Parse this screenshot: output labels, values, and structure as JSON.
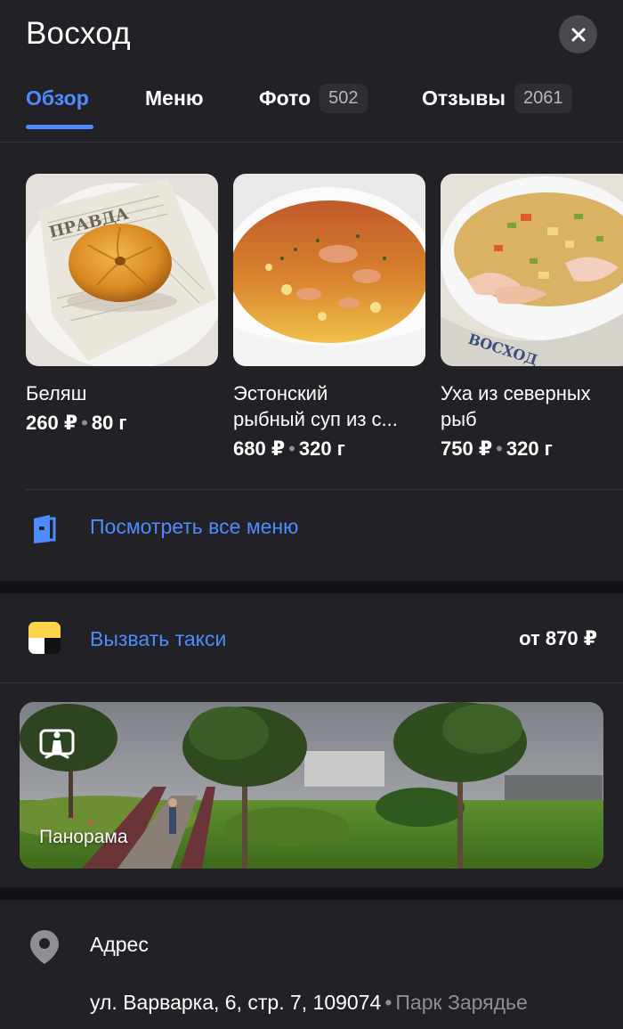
{
  "header": {
    "title": "Восход",
    "tabs": [
      {
        "label": "Обзор",
        "count": null,
        "active": true
      },
      {
        "label": "Меню",
        "count": null,
        "active": false
      },
      {
        "label": "Фото",
        "count": "502",
        "active": false
      },
      {
        "label": "Отзывы",
        "count": "2061",
        "active": false
      }
    ]
  },
  "menu": {
    "dishes": [
      {
        "name_line1": "Беляш",
        "name_line2": "",
        "price": "260 ₽",
        "weight": "80 г"
      },
      {
        "name_line1": "Эстонский",
        "name_line2": "рыбный суп из с...",
        "price": "680 ₽",
        "weight": "320 г"
      },
      {
        "name_line1": "Уха из северных",
        "name_line2": "рыб",
        "price": "750 ₽",
        "weight": "320 г"
      }
    ],
    "view_all_label": "Посмотреть все меню"
  },
  "taxi": {
    "label": "Вызвать такси",
    "price": "от 870 ₽"
  },
  "panorama": {
    "label": "Панорама"
  },
  "address": {
    "title": "Адрес",
    "street": "ул. Варварка, 6, стр. 7, 109074",
    "landmark": "Парк Зарядье"
  },
  "colors": {
    "accent": "#4d8bff",
    "background": "#222226",
    "taxi_yellow": "#fcd54a"
  },
  "icons": {
    "close": "close-icon",
    "menu": "menu-book-icon",
    "taxi": "yandex-taxi-icon",
    "panorama": "panorama-icon",
    "address": "location-pin-icon"
  }
}
